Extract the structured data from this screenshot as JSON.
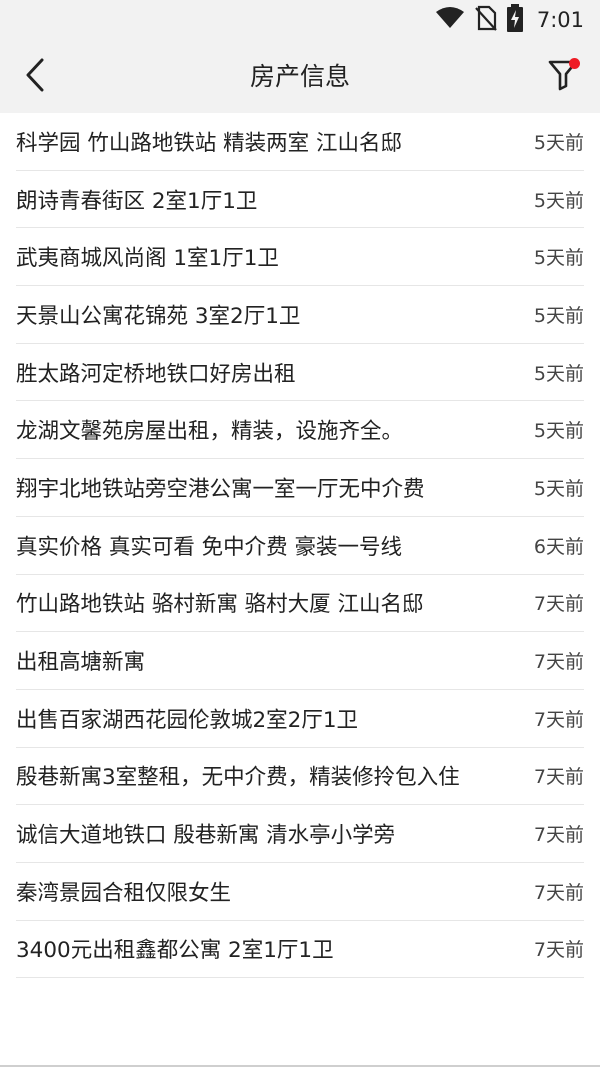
{
  "status_bar": {
    "time": "7:01",
    "icons": [
      "wifi-icon",
      "no-sim-icon",
      "battery-charging-icon"
    ]
  },
  "header": {
    "title": "房产信息",
    "back_icon": "chevron-left-icon",
    "filter_icon": "filter-icon",
    "filter_badge_color": "#ee1c25"
  },
  "listings": [
    {
      "title": "科学园 竹山路地铁站 精装两室 江山名邸",
      "time": "5天前"
    },
    {
      "title": "朗诗青春街区 2室1厅1卫",
      "time": "5天前"
    },
    {
      "title": "武夷商城风尚阁 1室1厅1卫",
      "time": "5天前"
    },
    {
      "title": "天景山公寓花锦苑 3室2厅1卫",
      "time": "5天前"
    },
    {
      "title": "胜太路河定桥地铁口好房出租",
      "time": "5天前"
    },
    {
      "title": "龙湖文馨苑房屋出租，精装，设施齐全。",
      "time": "5天前"
    },
    {
      "title": "翔宇北地铁站旁空港公寓一室一厅无中介费",
      "time": "5天前"
    },
    {
      "title": "真实价格 真实可看 免中介费 豪装一号线",
      "time": "6天前"
    },
    {
      "title": "竹山路地铁站 骆村新寓 骆村大厦 江山名邸",
      "time": "7天前"
    },
    {
      "title": "出租高塘新寓",
      "time": "7天前"
    },
    {
      "title": "出售百家湖西花园伦敦城2室2厅1卫",
      "time": "7天前"
    },
    {
      "title": "殷巷新寓3室整租，无中介费，精装修拎包入住",
      "time": "7天前"
    },
    {
      "title": "诚信大道地铁口 殷巷新寓 清水亭小学旁",
      "time": "7天前"
    },
    {
      "title": "秦湾景园合租仅限女生",
      "time": "7天前"
    },
    {
      "title": "3400元出租鑫都公寓 2室1厅1卫",
      "time": "7天前"
    }
  ]
}
